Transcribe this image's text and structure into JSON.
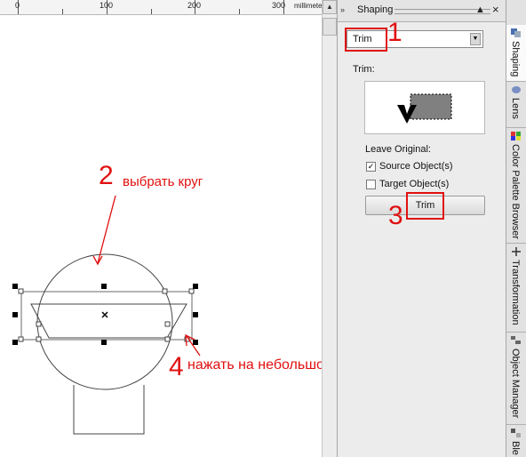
{
  "ruler": {
    "labels": [
      "0",
      "100",
      "200",
      "300"
    ],
    "unit_label": "millimeters"
  },
  "docker": {
    "title": "Shaping",
    "mode_value": "Trim",
    "section_label": "Trim:",
    "leave_original_label": "Leave Original:",
    "source_objects_label": "Source Object(s)",
    "source_checked": true,
    "target_objects_label": "Target Object(s)",
    "target_checked": false,
    "trim_button_label": "Trim"
  },
  "tabs": [
    {
      "label": "Shaping",
      "icon": "shaping-icon",
      "active": true
    },
    {
      "label": "Lens",
      "icon": "lens-icon",
      "active": false
    },
    {
      "label": "Color Palette Browser",
      "icon": "palette-icon",
      "active": false
    },
    {
      "label": "Transformation",
      "icon": "transform-icon",
      "active": false
    },
    {
      "label": "Object Manager",
      "icon": "object-manager-icon",
      "active": false
    },
    {
      "label": "Ble",
      "icon": "blend-icon",
      "active": false
    }
  ],
  "annotations": {
    "a1_num": "1",
    "a2_num": "2",
    "a2_text": "выбрать круг",
    "a3_num": "3",
    "a4_num": "4",
    "a4_text": "нажать на небольшой прямоугольник"
  },
  "colors": {
    "annotation": "#e01010",
    "preview_rect": "#808080"
  }
}
